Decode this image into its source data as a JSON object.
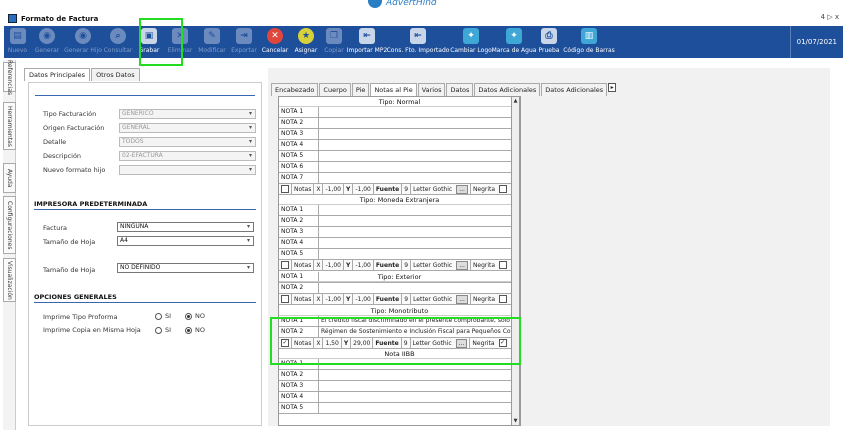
{
  "brand": {
    "name": "AdvertHind"
  },
  "window": {
    "title": "Formato de Factura",
    "controls": "4 ▷ x"
  },
  "toolbar": {
    "items": [
      {
        "label": "Nuevo",
        "icon": "new-doc-icon",
        "enabled": false
      },
      {
        "label": "Generar",
        "icon": "generate-icon",
        "enabled": false
      },
      {
        "label": "Generar Hijo",
        "icon": "generate-child-icon",
        "enabled": false
      },
      {
        "label": "Consultar",
        "icon": "query-icon",
        "enabled": false
      },
      {
        "label": "Grabar",
        "icon": "save-icon",
        "enabled": true
      },
      {
        "label": "Eliminar",
        "icon": "delete-icon",
        "enabled": false
      },
      {
        "label": "Modificar",
        "icon": "edit-icon",
        "enabled": false
      },
      {
        "label": "Exportar",
        "icon": "export-icon",
        "enabled": false
      },
      {
        "label": "Cancelar",
        "icon": "cancel-icon",
        "enabled": true
      },
      {
        "label": "Asignar",
        "icon": "assign-icon",
        "enabled": true
      },
      {
        "label": "Copiar",
        "icon": "copy-icon",
        "enabled": false
      },
      {
        "label": "Importar MP2",
        "icon": "import-icon",
        "enabled": true
      },
      {
        "label": "Cons. Fto. Importado",
        "icon": "imported-format-icon",
        "enabled": true
      },
      {
        "label": "Cambiar Logo",
        "icon": "change-logo-icon",
        "enabled": true
      },
      {
        "label": "Marca de Agua",
        "icon": "watermark-icon",
        "enabled": true
      },
      {
        "label": "Prueba",
        "icon": "printer-icon",
        "enabled": true
      },
      {
        "label": "Código de Barras",
        "icon": "barcode-icon",
        "enabled": true
      }
    ],
    "date": "01/07/2021"
  },
  "sidetabs": [
    "Referencias",
    "Herramientas",
    "Ayuda",
    "Configuraciones",
    "Visualización"
  ],
  "left": {
    "tabs": [
      "Datos Principales",
      "Otros Datos"
    ],
    "fields": {
      "tipo_facturacion": {
        "label": "Tipo Facturación",
        "value": "GENERICO"
      },
      "origen_facturacion": {
        "label": "Origen Facturación",
        "value": "GENERAL"
      },
      "detalle": {
        "label": "Detalle",
        "value": "TODOS"
      },
      "descripcion": {
        "label": "Descripción",
        "value": "02-EFACTURA"
      },
      "nuevo_formato": {
        "label": "Nuevo formato hijo",
        "value": ""
      }
    },
    "impresora": {
      "section": "IMPRESORA PREDETERMINADA",
      "factura": {
        "label": "Factura",
        "value": "NINGUNA"
      },
      "tamano1": {
        "label": "Tamaño de Hoja",
        "value": "A4"
      },
      "tamano2": {
        "label": "Tamaño de Hoja",
        "value": "NO DEFINIDO"
      }
    },
    "opciones": {
      "section": "OPCIONES GENERALES",
      "proforma": {
        "label": "Imprime Tipo Proforma",
        "si": "SI",
        "no": "NO"
      },
      "copia": {
        "label": "Imprime Copia en Misma Hoja",
        "si": "SI",
        "no": "NO"
      }
    }
  },
  "right": {
    "tabs": [
      "Encabezado",
      "Cuerpo",
      "Pie",
      "Notas al Pie",
      "Varios",
      "Datos",
      "Datos Adicionales",
      "Datos Adicionales"
    ],
    "scroll_arrow": "▸",
    "groups": {
      "normal": {
        "title": "Tipo: Normal",
        "rows": [
          "NOTA 1",
          "NOTA 2",
          "NOTA 3",
          "NOTA 4",
          "NOTA 5",
          "NOTA 6",
          "NOTA 7"
        ]
      },
      "moneda": {
        "title": "Tipo: Moneda Extranjera",
        "rows": [
          "NOTA 1",
          "NOTA 2",
          "NOTA 3",
          "NOTA 4",
          "NOTA 5"
        ]
      },
      "exterior": {
        "title": "Tipo: Exterior",
        "rows": [
          "NOTA 1",
          "NOTA 2"
        ]
      },
      "monotributo": {
        "title": "Tipo: Monotributo",
        "rows": [
          "NOTA 1",
          "NOTA 2"
        ],
        "values": [
          "El crédito fiscal discriminado en el presente comprobante, sólo podrá",
          "Régimen de Sostenimiento e Inclusión Fiscal para Pequeños Contribuyentes"
        ]
      },
      "iibb": {
        "title": "Nota IIBB",
        "rows": [
          "NOTA 1",
          "NOTA 2",
          "NOTA 3",
          "NOTA 4",
          "NOTA 5"
        ]
      }
    },
    "footer": {
      "notas": "Notas",
      "x": "X",
      "y": "Y",
      "fuente": "Fuente",
      "size": "9",
      "font": "Letter Gothic",
      "more": "...",
      "negrita": "Negrita",
      "std": {
        "xv": "-1,00",
        "yv": "-1,00"
      },
      "mono": {
        "xv": "1,50",
        "yv": "29,00"
      }
    }
  }
}
